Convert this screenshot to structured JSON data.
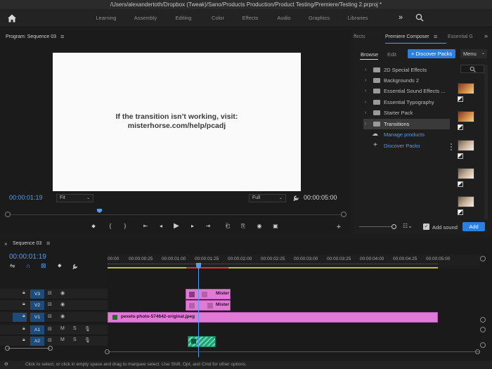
{
  "window": {
    "title": "/Users/alexandertoth/Dropbox (Tweak)/Sano/Products Production/Product Testing/Premiere/Testing 2.prproj *"
  },
  "workspaces": [
    "Learning",
    "Assembly",
    "Editing",
    "Color",
    "Effects",
    "Audio",
    "Graphics",
    "Libraries"
  ],
  "program": {
    "title": "Program: Sequence 03",
    "menu_glyph": "≡",
    "video_text_line1": "If the transition isn’t working, visit:",
    "video_text_line2": "misterhorse.com/help/pcadj",
    "current_tc": "00:00:01:19",
    "duration_tc": "00:00:05:00",
    "fit_label": "Fit",
    "quality_label": "Full"
  },
  "right_panel": {
    "tab_effects": "ffects",
    "tab_composer": "Premiere Composer",
    "tab_essential": "Essential G",
    "browse_label": "Browse",
    "edit_label": "Edit",
    "discover_button": "+ Discover Packs",
    "menu_label": "Menu",
    "tree": [
      {
        "label": "2D Special Effects"
      },
      {
        "label": "Backgrounds 2"
      },
      {
        "label": "Essential Sound Effects ..."
      },
      {
        "label": "Essential Typography"
      },
      {
        "label": "Starter Pack"
      },
      {
        "label": "Transitions"
      }
    ],
    "manage_products": "Manage products",
    "discover_packs": "Discover Packs",
    "add_sound": "Add sound",
    "add_button": "Add"
  },
  "timeline": {
    "title": "Sequence 03",
    "current_tc": "00:00:01:19",
    "ruler": [
      "00:00",
      "00:00:00:25",
      "00:00:01:00",
      "00:00:01:25",
      "00:00:02:00",
      "00:00:02:25",
      "00:00:03:00",
      "00:00:03:25",
      "00:00:04:00",
      "00:00:04:25",
      "00:00:05:00"
    ],
    "tracks": {
      "v3": "V3",
      "v2": "V2",
      "v1": "V1",
      "a1": "A1",
      "a2": "A2",
      "m": "M",
      "s": "S"
    },
    "clip_mister": "Mister",
    "clip_v1": "pexels-photo-574642-original.jpeg"
  },
  "status": "Click to select, or click in empty space and drag to marquee select. Use Shift, Opt, and Cmd for other options.",
  "colors": {
    "accent": "#2b7fe0",
    "clip_pink": "#e07ad6",
    "clip_green": "#1fa47a",
    "playhead": "#4f9df5"
  }
}
